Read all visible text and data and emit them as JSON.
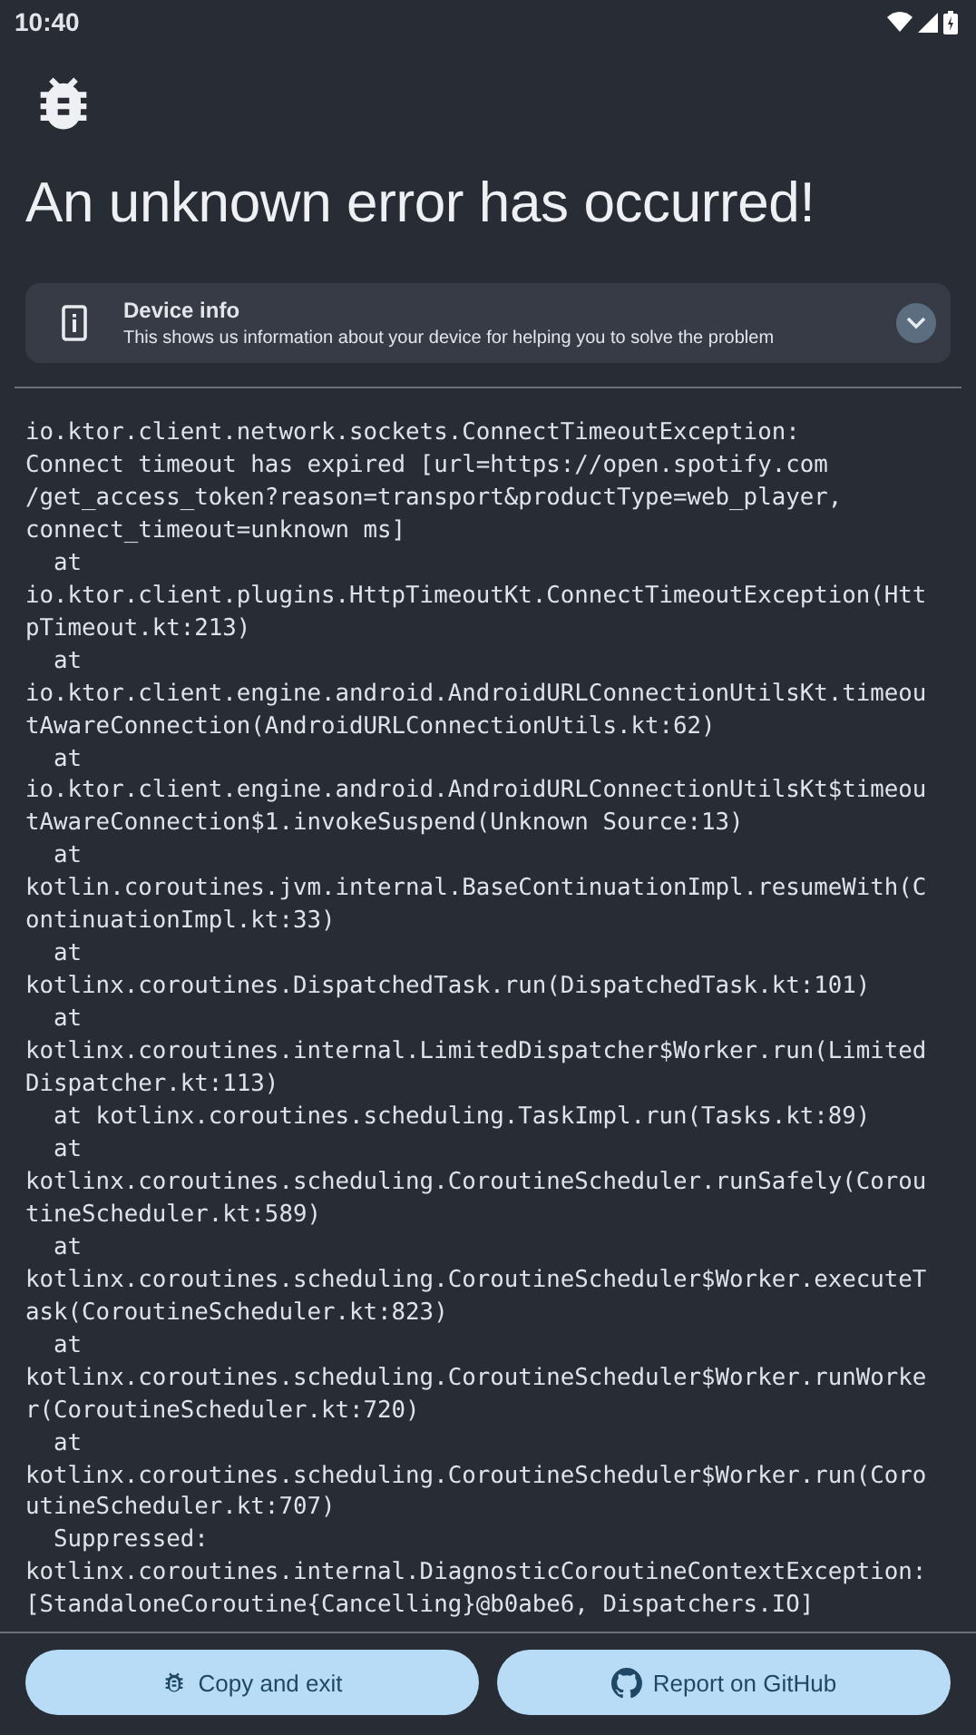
{
  "status_bar": {
    "time": "10:40"
  },
  "title": "An unknown error has occurred!",
  "device_info": {
    "title": "Device info",
    "subtitle": "This shows us information about your device for helping you to solve the problem",
    "expanded": false
  },
  "stack_trace": [
    "io.ktor.client.network.sockets.ConnectTimeoutException:",
    "Connect timeout has expired [url=https://open.spotify.com",
    "/get_access_token?reason=transport&productType=web_player,",
    "connect_timeout=unknown ms]",
    "  at",
    "io.ktor.client.plugins.HttpTimeoutKt.ConnectTimeoutException(Htt",
    "pTimeout.kt:213)",
    "  at",
    "io.ktor.client.engine.android.AndroidURLConnectionUtilsKt.timeou",
    "tAwareConnection(AndroidURLConnectionUtils.kt:62)",
    "  at",
    "io.ktor.client.engine.android.AndroidURLConnectionUtilsKt$timeou",
    "tAwareConnection$1.invokeSuspend(Unknown Source:13)",
    "  at",
    "kotlin.coroutines.jvm.internal.BaseContinuationImpl.resumeWith(C",
    "ontinuationImpl.kt:33)",
    "  at",
    "kotlinx.coroutines.DispatchedTask.run(DispatchedTask.kt:101)",
    "  at",
    "kotlinx.coroutines.internal.LimitedDispatcher$Worker.run(Limited",
    "Dispatcher.kt:113)",
    "  at kotlinx.coroutines.scheduling.TaskImpl.run(Tasks.kt:89)",
    "  at",
    "kotlinx.coroutines.scheduling.CoroutineScheduler.runSafely(Corou",
    "tineScheduler.kt:589)",
    "  at",
    "kotlinx.coroutines.scheduling.CoroutineScheduler$Worker.executeT",
    "ask(CoroutineScheduler.kt:823)",
    "  at",
    "kotlinx.coroutines.scheduling.CoroutineScheduler$Worker.runWorke",
    "r(CoroutineScheduler.kt:720)",
    "  at",
    "kotlinx.coroutines.scheduling.CoroutineScheduler$Worker.run(Coro",
    "utineScheduler.kt:707)",
    "  Suppressed:",
    "kotlinx.coroutines.internal.DiagnosticCoroutineContextException:",
    "[StandaloneCoroutine{Cancelling}@b0abe6, Dispatchers.IO]"
  ],
  "buttons": [
    {
      "kind": "copy",
      "label": "Copy and exit"
    },
    {
      "kind": "github",
      "label": "Report on GitHub"
    }
  ]
}
